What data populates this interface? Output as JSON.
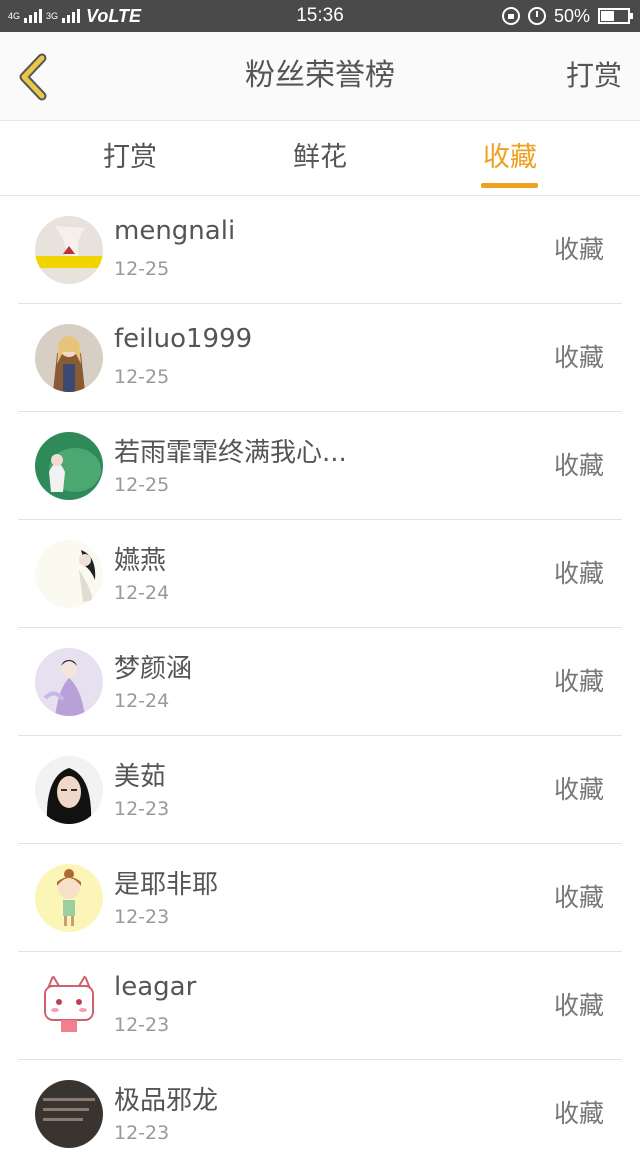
{
  "status_bar": {
    "signal_label_1": "4G",
    "signal_label_2": "3G",
    "network": "VoLTE",
    "time": "15:36",
    "battery": "50%",
    "battery_level": 0.5,
    "icons": [
      "lock-rotation-icon",
      "alarm-icon",
      "battery-icon"
    ]
  },
  "header": {
    "title": "粉丝荣誉榜",
    "action": "打赏",
    "back_icon": "chevron-left-icon",
    "back_color": "#e8c84a"
  },
  "tabs": [
    {
      "label": "打赏",
      "active": false
    },
    {
      "label": "鲜花",
      "active": false
    },
    {
      "label": "收藏",
      "active": true
    }
  ],
  "accent_color": "#f0a020",
  "list": [
    {
      "name": "mengnali",
      "date": "12-25",
      "action": "收藏"
    },
    {
      "name": "feiluo1999",
      "date": "12-25",
      "action": "收藏"
    },
    {
      "name": "若雨霏霏终满我心...",
      "date": "12-25",
      "action": "收藏"
    },
    {
      "name": "嬿燕",
      "date": "12-24",
      "action": "收藏"
    },
    {
      "name": "梦颜涵",
      "date": "12-24",
      "action": "收藏"
    },
    {
      "name": "美茹",
      "date": "12-23",
      "action": "收藏"
    },
    {
      "name": "是耶非耶",
      "date": "12-23",
      "action": "收藏"
    },
    {
      "name": "leagar",
      "date": "12-23",
      "action": "收藏"
    },
    {
      "name": "极品邪龙",
      "date": "12-23",
      "action": "收藏"
    }
  ]
}
